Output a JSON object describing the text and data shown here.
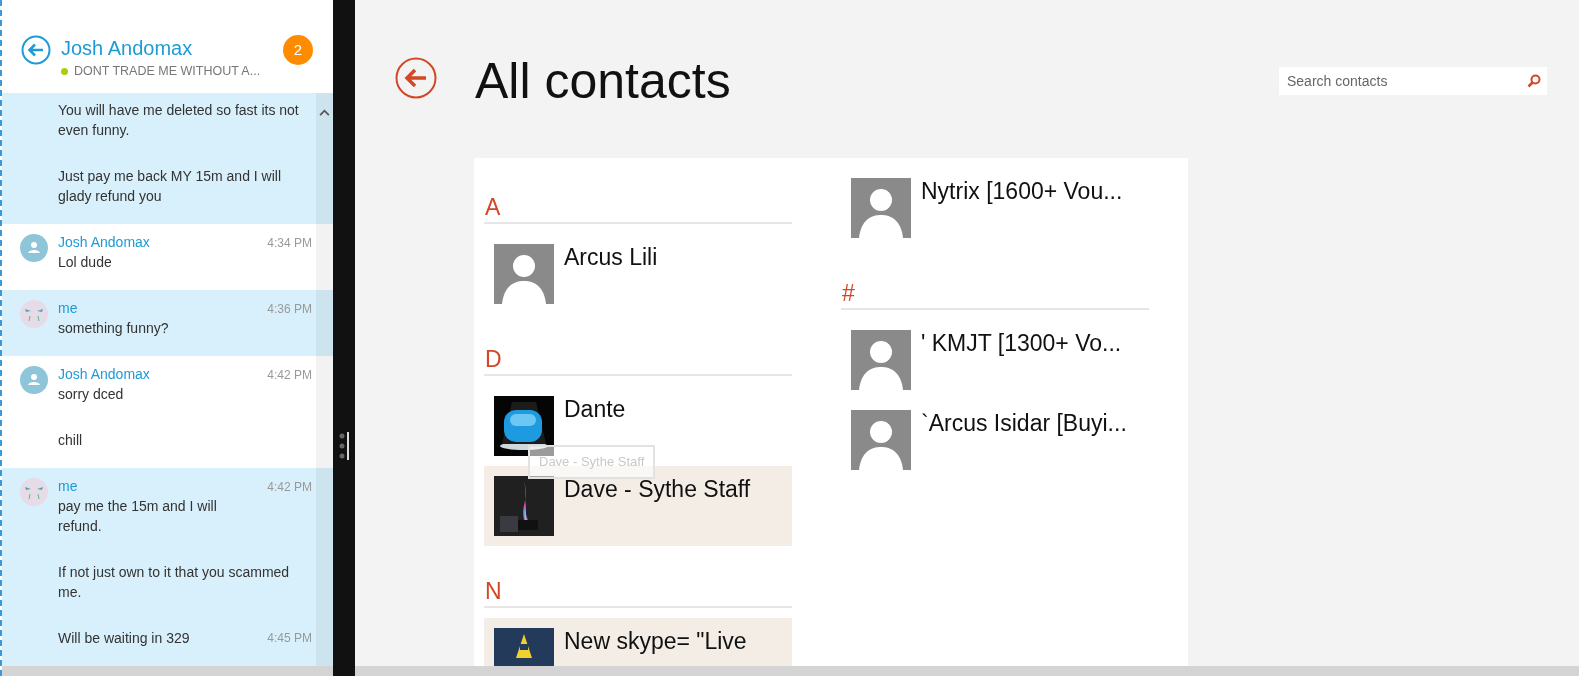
{
  "chat": {
    "contact_name": "Josh Andomax",
    "status": "DONT TRADE ME WITHOUT A...",
    "online": true,
    "unread": "2",
    "messages": [
      {
        "mine": true,
        "paragraphs": [
          {
            "text": "You will have me deleted so fast its not even funny."
          },
          {
            "text": "Just pay me back MY 15m and I will glady refund you"
          }
        ]
      },
      {
        "mine": false,
        "sender": "Josh Andomax",
        "time": "4:34 PM",
        "paragraphs": [
          {
            "text": "Lol dude"
          }
        ]
      },
      {
        "mine": true,
        "sender": "me",
        "time": "4:36 PM",
        "paragraphs": [
          {
            "text": "something funny?"
          }
        ]
      },
      {
        "mine": false,
        "sender": "Josh Andomax",
        "time": "4:42 PM",
        "paragraphs": [
          {
            "text": "sorry dced"
          },
          {
            "text": "chill"
          }
        ]
      },
      {
        "mine": true,
        "sender": "me",
        "time": "4:42 PM",
        "paragraphs": [
          {
            "text": "pay me the 15m and I will\nrefund."
          },
          {
            "text": "If not just own to it that you scammed me."
          },
          {
            "text": "Will be waiting in 329",
            "time": "4:45 PM"
          }
        ]
      }
    ]
  },
  "contacts": {
    "title": "All contacts",
    "search": {
      "placeholder": "Search contacts"
    },
    "tooltip": "Dave - Sythe Staff",
    "columns": [
      [
        {
          "letter": "A",
          "items": [
            {
              "name": "Arcus Lili",
              "kind": "default",
              "selected": false
            }
          ]
        },
        {
          "letter": "D",
          "items": [
            {
              "name": "Dante",
              "kind": "picture",
              "selected": false
            },
            {
              "name": "Dave - Sythe Staff",
              "kind": "picture",
              "selected": true
            }
          ]
        },
        {
          "letter": "N",
          "items": [
            {
              "name": "New skype= \"Live",
              "kind": "picture",
              "selected": true
            }
          ]
        }
      ],
      [
        {
          "items": [
            {
              "name": "Nytrix [1600+ Vou...",
              "kind": "default",
              "selected": false
            }
          ]
        },
        {
          "letter": "#",
          "items": [
            {
              "name": "' KMJT [1300+ Vo...",
              "kind": "default",
              "selected": false
            },
            {
              "name": "`Arcus Isidar [Buyi...",
              "kind": "default",
              "selected": false
            }
          ]
        }
      ]
    ]
  }
}
